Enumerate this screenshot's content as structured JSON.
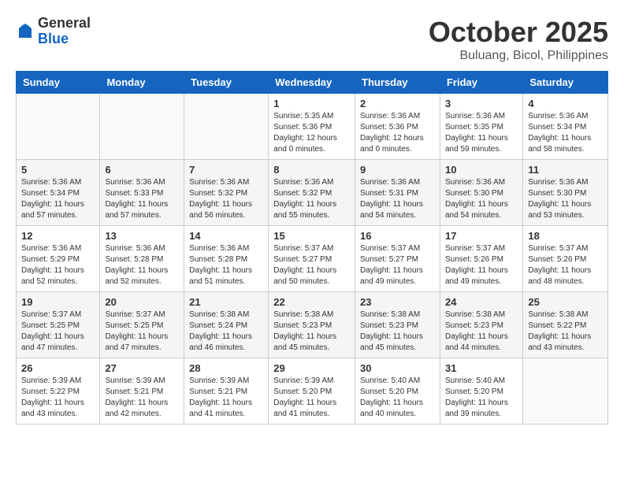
{
  "header": {
    "logo_general": "General",
    "logo_blue": "Blue",
    "month_title": "October 2025",
    "location": "Buluang, Bicol, Philippines"
  },
  "weekdays": [
    "Sunday",
    "Monday",
    "Tuesday",
    "Wednesday",
    "Thursday",
    "Friday",
    "Saturday"
  ],
  "weeks": [
    [
      {
        "day": "",
        "info": ""
      },
      {
        "day": "",
        "info": ""
      },
      {
        "day": "",
        "info": ""
      },
      {
        "day": "1",
        "info": "Sunrise: 5:35 AM\nSunset: 5:36 PM\nDaylight: 12 hours\nand 0 minutes."
      },
      {
        "day": "2",
        "info": "Sunrise: 5:36 AM\nSunset: 5:36 PM\nDaylight: 12 hours\nand 0 minutes."
      },
      {
        "day": "3",
        "info": "Sunrise: 5:36 AM\nSunset: 5:35 PM\nDaylight: 11 hours\nand 59 minutes."
      },
      {
        "day": "4",
        "info": "Sunrise: 5:36 AM\nSunset: 5:34 PM\nDaylight: 11 hours\nand 58 minutes."
      }
    ],
    [
      {
        "day": "5",
        "info": "Sunrise: 5:36 AM\nSunset: 5:34 PM\nDaylight: 11 hours\nand 57 minutes."
      },
      {
        "day": "6",
        "info": "Sunrise: 5:36 AM\nSunset: 5:33 PM\nDaylight: 11 hours\nand 57 minutes."
      },
      {
        "day": "7",
        "info": "Sunrise: 5:36 AM\nSunset: 5:32 PM\nDaylight: 11 hours\nand 56 minutes."
      },
      {
        "day": "8",
        "info": "Sunrise: 5:36 AM\nSunset: 5:32 PM\nDaylight: 11 hours\nand 55 minutes."
      },
      {
        "day": "9",
        "info": "Sunrise: 5:36 AM\nSunset: 5:31 PM\nDaylight: 11 hours\nand 54 minutes."
      },
      {
        "day": "10",
        "info": "Sunrise: 5:36 AM\nSunset: 5:30 PM\nDaylight: 11 hours\nand 54 minutes."
      },
      {
        "day": "11",
        "info": "Sunrise: 5:36 AM\nSunset: 5:30 PM\nDaylight: 11 hours\nand 53 minutes."
      }
    ],
    [
      {
        "day": "12",
        "info": "Sunrise: 5:36 AM\nSunset: 5:29 PM\nDaylight: 11 hours\nand 52 minutes."
      },
      {
        "day": "13",
        "info": "Sunrise: 5:36 AM\nSunset: 5:28 PM\nDaylight: 11 hours\nand 52 minutes."
      },
      {
        "day": "14",
        "info": "Sunrise: 5:36 AM\nSunset: 5:28 PM\nDaylight: 11 hours\nand 51 minutes."
      },
      {
        "day": "15",
        "info": "Sunrise: 5:37 AM\nSunset: 5:27 PM\nDaylight: 11 hours\nand 50 minutes."
      },
      {
        "day": "16",
        "info": "Sunrise: 5:37 AM\nSunset: 5:27 PM\nDaylight: 11 hours\nand 49 minutes."
      },
      {
        "day": "17",
        "info": "Sunrise: 5:37 AM\nSunset: 5:26 PM\nDaylight: 11 hours\nand 49 minutes."
      },
      {
        "day": "18",
        "info": "Sunrise: 5:37 AM\nSunset: 5:26 PM\nDaylight: 11 hours\nand 48 minutes."
      }
    ],
    [
      {
        "day": "19",
        "info": "Sunrise: 5:37 AM\nSunset: 5:25 PM\nDaylight: 11 hours\nand 47 minutes."
      },
      {
        "day": "20",
        "info": "Sunrise: 5:37 AM\nSunset: 5:25 PM\nDaylight: 11 hours\nand 47 minutes."
      },
      {
        "day": "21",
        "info": "Sunrise: 5:38 AM\nSunset: 5:24 PM\nDaylight: 11 hours\nand 46 minutes."
      },
      {
        "day": "22",
        "info": "Sunrise: 5:38 AM\nSunset: 5:23 PM\nDaylight: 11 hours\nand 45 minutes."
      },
      {
        "day": "23",
        "info": "Sunrise: 5:38 AM\nSunset: 5:23 PM\nDaylight: 11 hours\nand 45 minutes."
      },
      {
        "day": "24",
        "info": "Sunrise: 5:38 AM\nSunset: 5:23 PM\nDaylight: 11 hours\nand 44 minutes."
      },
      {
        "day": "25",
        "info": "Sunrise: 5:38 AM\nSunset: 5:22 PM\nDaylight: 11 hours\nand 43 minutes."
      }
    ],
    [
      {
        "day": "26",
        "info": "Sunrise: 5:39 AM\nSunset: 5:22 PM\nDaylight: 11 hours\nand 43 minutes."
      },
      {
        "day": "27",
        "info": "Sunrise: 5:39 AM\nSunset: 5:21 PM\nDaylight: 11 hours\nand 42 minutes."
      },
      {
        "day": "28",
        "info": "Sunrise: 5:39 AM\nSunset: 5:21 PM\nDaylight: 11 hours\nand 41 minutes."
      },
      {
        "day": "29",
        "info": "Sunrise: 5:39 AM\nSunset: 5:20 PM\nDaylight: 11 hours\nand 41 minutes."
      },
      {
        "day": "30",
        "info": "Sunrise: 5:40 AM\nSunset: 5:20 PM\nDaylight: 11 hours\nand 40 minutes."
      },
      {
        "day": "31",
        "info": "Sunrise: 5:40 AM\nSunset: 5:20 PM\nDaylight: 11 hours\nand 39 minutes."
      },
      {
        "day": "",
        "info": ""
      }
    ]
  ]
}
